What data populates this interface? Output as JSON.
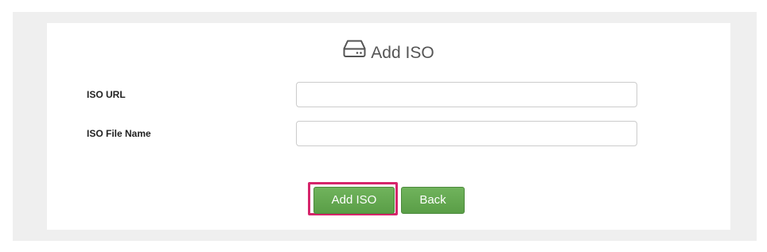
{
  "form": {
    "title": "Add ISO",
    "title_icon": "hard-drive-icon",
    "fields": [
      {
        "label": "ISO URL",
        "value": "",
        "placeholder": ""
      },
      {
        "label": "ISO File Name",
        "value": "",
        "placeholder": ""
      }
    ]
  },
  "actions": {
    "add_label": "Add ISO",
    "back_label": "Back",
    "accent_color": "#5fa54b",
    "highlight_color": "#d6256b"
  }
}
